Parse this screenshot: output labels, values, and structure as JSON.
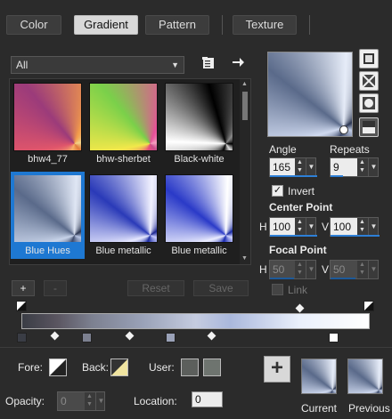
{
  "tabs": [
    {
      "label": "Color"
    },
    {
      "label": "Gradient",
      "active": true
    },
    {
      "label": "Pattern"
    },
    {
      "label": "Texture"
    }
  ],
  "category": {
    "selected": "All"
  },
  "gradients": [
    {
      "name": "bhw4_77"
    },
    {
      "name": "bhw-sherbet"
    },
    {
      "name": "Black-white"
    },
    {
      "name": "Blue Hues",
      "selected": true
    },
    {
      "name": "Blue metallic"
    },
    {
      "name": "Blue metallic"
    }
  ],
  "list_buttons": {
    "add": "+",
    "remove": "-",
    "reset": "Reset",
    "save": "Save"
  },
  "angle": {
    "label": "Angle",
    "value": "165"
  },
  "repeats": {
    "label": "Repeats",
    "value": "9"
  },
  "invert": {
    "label": "Invert",
    "checked": true
  },
  "center_point": {
    "label": "Center Point",
    "h_label": "H",
    "h": "100",
    "v_label": "V",
    "v": "100"
  },
  "focal_point": {
    "label": "Focal Point",
    "h_label": "H",
    "h": "50",
    "v_label": "V",
    "v": "50"
  },
  "link": {
    "label": "Link",
    "checked": false
  },
  "fore": {
    "label": "Fore:"
  },
  "back": {
    "label": "Back:"
  },
  "user": {
    "label": "User:",
    "colors": [
      "#5c5f5c",
      "#6e746f"
    ]
  },
  "opacity": {
    "label": "Opacity:",
    "value": "0"
  },
  "location": {
    "label": "Location:",
    "value": "0"
  },
  "current": {
    "label": "Current"
  },
  "previous": {
    "label": "Previous"
  },
  "colors": {
    "accent": "#1e78d2",
    "background": "#2b2b2b"
  }
}
